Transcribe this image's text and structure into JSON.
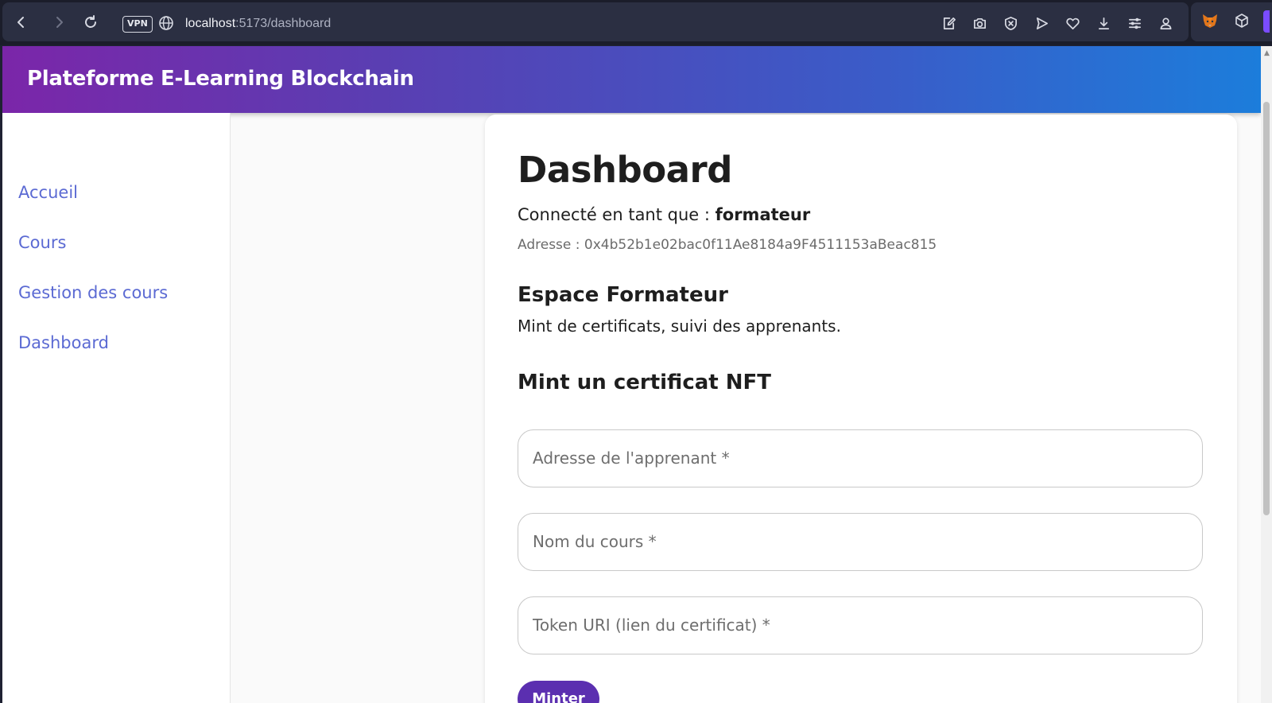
{
  "browser": {
    "url_host": "localhost",
    "url_path": ":5173/dashboard",
    "vpn_label": "VPN",
    "icons": [
      "back-icon",
      "forward-icon",
      "reload-icon",
      "globe-icon",
      "edit-icon",
      "camera-icon",
      "shield-icon",
      "send-icon",
      "heart-icon",
      "download-icon",
      "menu-icon",
      "profile-icon",
      "fox-extension-icon",
      "box-extension-icon"
    ]
  },
  "app": {
    "title": "Plateforme E-Learning Blockchain"
  },
  "sidebar": {
    "items": [
      {
        "label": "Accueil"
      },
      {
        "label": "Cours"
      },
      {
        "label": "Gestion des cours"
      },
      {
        "label": "Dashboard"
      }
    ],
    "link_color": "#5b6ad3"
  },
  "main": {
    "title": "Dashboard",
    "connected_prefix": "Connecté en tant que : ",
    "role": "formateur",
    "address": "Adresse : 0x4b52b1e02bac0f11Ae8184a9F4511153aBeac815",
    "section_title": "Espace Formateur",
    "section_desc": "Mint de certificats, suivi des apprenants.",
    "form_title": "Mint un certificat NFT",
    "fields": [
      {
        "placeholder": "Adresse de l'apprenant *",
        "value": ""
      },
      {
        "placeholder": "Nom du cours *",
        "value": ""
      },
      {
        "placeholder": "Token URI (lien du certificat) *",
        "value": ""
      }
    ],
    "submit_label": "Minter"
  },
  "colors": {
    "header_gradient_start": "#7b26a9",
    "header_gradient_end": "#1c7ddb",
    "button": "#5b2fb0"
  }
}
